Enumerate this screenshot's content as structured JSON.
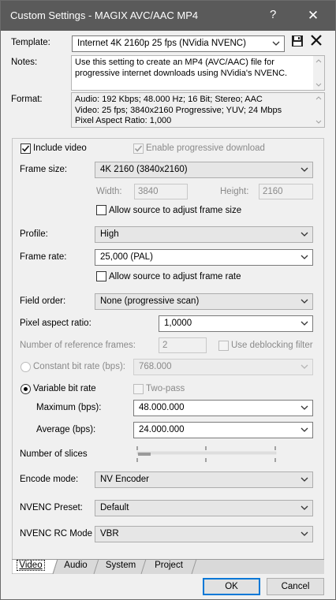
{
  "window": {
    "title": "Custom Settings - MAGIX AVC/AAC MP4",
    "help_glyph": "?",
    "close_glyph": "✕"
  },
  "template": {
    "label": "Template:",
    "value": "Internet 4K 2160p 25 fps (NVidia NVENC)"
  },
  "notes": {
    "label": "Notes:",
    "text": "Use this setting to create an MP4 (AVC/AAC) file for progressive internet downloads using NVidia's NVENC."
  },
  "format": {
    "label": "Format:",
    "lines": [
      "Audio: 192 Kbps; 48.000 Hz; 16 Bit; Stereo; AAC",
      "Video: 25 fps; 3840x2160 Progressive; YUV; 24 Mbps",
      "Pixel Aspect Ratio: 1,000"
    ]
  },
  "video": {
    "include_video_label": "Include video",
    "include_video_checked": true,
    "progressive_label": "Enable progressive download",
    "progressive_checked": true,
    "frame_size_label": "Frame size:",
    "frame_size_value": "4K 2160 (3840x2160)",
    "width_label": "Width:",
    "width_value": "3840",
    "height_label": "Height:",
    "height_value": "2160",
    "allow_frame_size_label": "Allow source to adjust frame size",
    "profile_label": "Profile:",
    "profile_value": "High",
    "frame_rate_label": "Frame rate:",
    "frame_rate_value": "25,000 (PAL)",
    "allow_frame_rate_label": "Allow source to adjust frame rate",
    "field_order_label": "Field order:",
    "field_order_value": "None (progressive scan)",
    "par_label": "Pixel aspect ratio:",
    "par_value": "1,0000",
    "ref_frames_label": "Number of reference frames:",
    "ref_frames_value": "2",
    "deblocking_label": "Use deblocking filter",
    "cbr_label": "Constant bit rate (bps):",
    "cbr_value": "768.000",
    "vbr_label": "Variable bit rate",
    "two_pass_label": "Two-pass",
    "max_label": "Maximum (bps):",
    "max_value": "48.000.000",
    "avg_label": "Average (bps):",
    "avg_value": "24.000.000",
    "slices_label": "Number of slices",
    "slices_level": 0,
    "encode_mode_label": "Encode mode:",
    "encode_mode_value": "NV Encoder",
    "nvenc_preset_label": "NVENC Preset:",
    "nvenc_preset_value": "Default",
    "nvenc_rc_label": "NVENC RC Mode",
    "nvenc_rc_value": "VBR"
  },
  "tabs": [
    "Video",
    "Audio",
    "System",
    "Project"
  ],
  "active_tab": "Video",
  "buttons": {
    "ok": "OK",
    "cancel": "Cancel"
  },
  "icons": {
    "save": "floppy-disk-icon",
    "delete": "x-delete-icon"
  },
  "colors": {
    "titlebar": "#5a5a5a",
    "default_button_border": "#0078d7",
    "dialog_bg": "#f0f0f0"
  }
}
